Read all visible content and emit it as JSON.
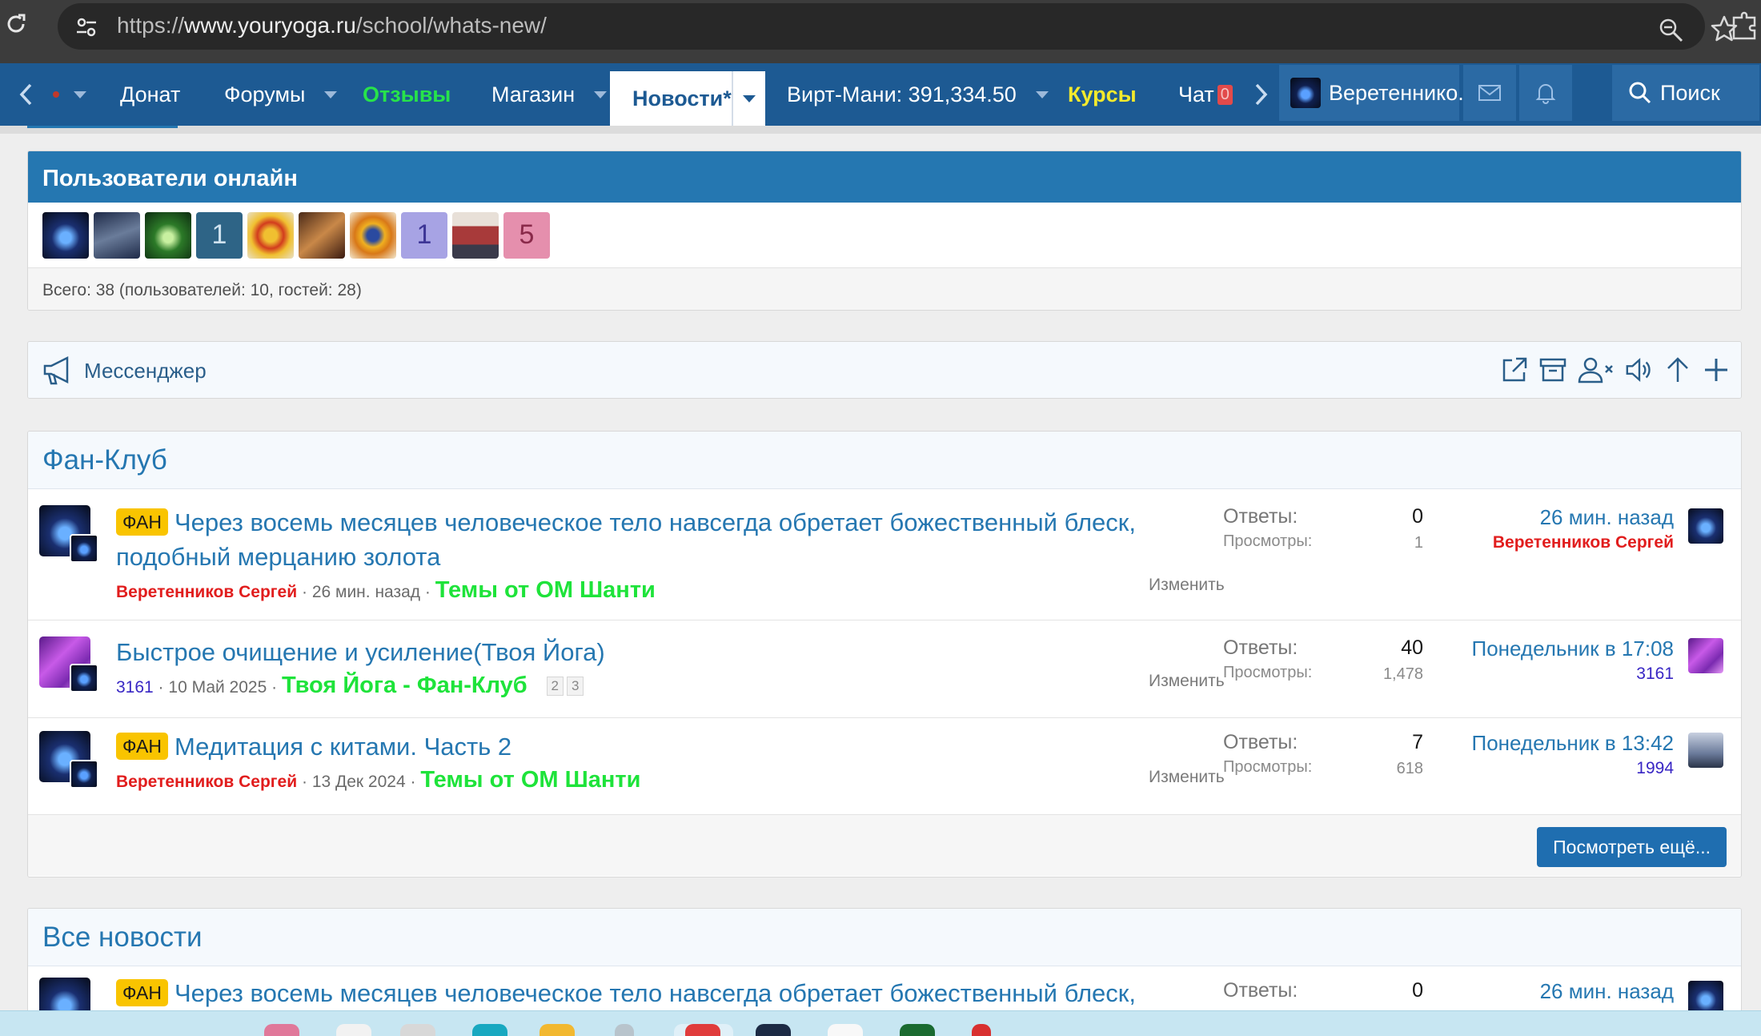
{
  "browser": {
    "url_scheme": "https://",
    "url_host": "www.youryoga.ru",
    "url_path": "/school/whats-new/",
    "icons": [
      "reload-icon",
      "site-info-icon",
      "zoom-icon",
      "star-icon",
      "extensions-icon"
    ]
  },
  "nav": {
    "items": [
      {
        "label": "Донат",
        "has_caret": false
      },
      {
        "label": "Форумы",
        "has_caret": true
      },
      {
        "label": "Отзывы",
        "color": "#27e34a"
      },
      {
        "label": "Магазин",
        "has_caret": true
      },
      {
        "label": "Новости*",
        "active": true,
        "has_caret": true
      },
      {
        "label": "Вирт-Мани: 391,334.50",
        "has_caret": true
      },
      {
        "label": "Курсы",
        "color": "#f3ea2c"
      },
      {
        "label": "Чат",
        "badge": "0"
      }
    ],
    "user_name": "Веретеннико...",
    "search_label": "Поиск"
  },
  "online": {
    "title": "Пользователи онлайн",
    "avatar_letters": [
      "1",
      "1",
      "5"
    ],
    "total": "Всего: 38 (пользователей: 10, гостей: 28)"
  },
  "messenger": {
    "label": "Мессенджер",
    "tools": [
      "external-link-icon",
      "archive-icon",
      "user-remove-icon",
      "sound-icon",
      "arrow-up-icon",
      "plus-icon"
    ]
  },
  "fan_club": {
    "title": "Фан-Клуб",
    "threads": [
      {
        "prefix": "ФАН",
        "title_line1": "Через восемь месяцев человеческое тело навсегда обретает божественный блеск,",
        "title_line2": "подобный мерцанию золота",
        "author": "Веретенников Сергей",
        "date": "26 мин. назад",
        "forum": "Темы от ОМ Шанти",
        "edit": "Изменить",
        "replies_label": "Ответы:",
        "replies": "0",
        "views_label": "Просмотры:",
        "views": "1",
        "last_time": "26 мин. назад",
        "last_user": "Веретенников Сергей"
      },
      {
        "prefix": "",
        "title_line1": "Быстрое очищение и усиление(Твоя Йога)",
        "author": "3161",
        "date": "10 Май 2025",
        "forum": "Твоя Йога - Фан-Клуб",
        "pages": [
          "2",
          "3"
        ],
        "edit": "Изменить",
        "replies_label": "Ответы:",
        "replies": "40",
        "views_label": "Просмотры:",
        "views": "1,478",
        "last_time": "Понедельник в 17:08",
        "last_user": "3161"
      },
      {
        "prefix": "ФАН",
        "title_line1": "Медитация с китами. Часть 2",
        "author": "Веретенников Сергей",
        "date": "13 Дек 2024",
        "forum": "Темы от ОМ Шанти",
        "edit": "Изменить",
        "replies_label": "Ответы:",
        "replies": "7",
        "views_label": "Просмотры:",
        "views": "618",
        "last_time": "Понедельник в 13:42",
        "last_user": "1994"
      }
    ],
    "more_button": "Посмотреть ещё..."
  },
  "all_news": {
    "title": "Все новости",
    "first": {
      "prefix": "ФАН",
      "title": "Через восемь месяцев человеческое тело навсегда обретает божественный блеск,",
      "replies_label": "Ответы:",
      "replies": "0",
      "last_time": "26 мин. назад"
    }
  },
  "colors": {
    "nav_bg": "#1d5a93",
    "block_head": "#2577b1",
    "link": "#2577b1",
    "author_red": "#e11d1d",
    "forum_green": "#1ee33a",
    "prefix_yellow": "#f9c400"
  }
}
